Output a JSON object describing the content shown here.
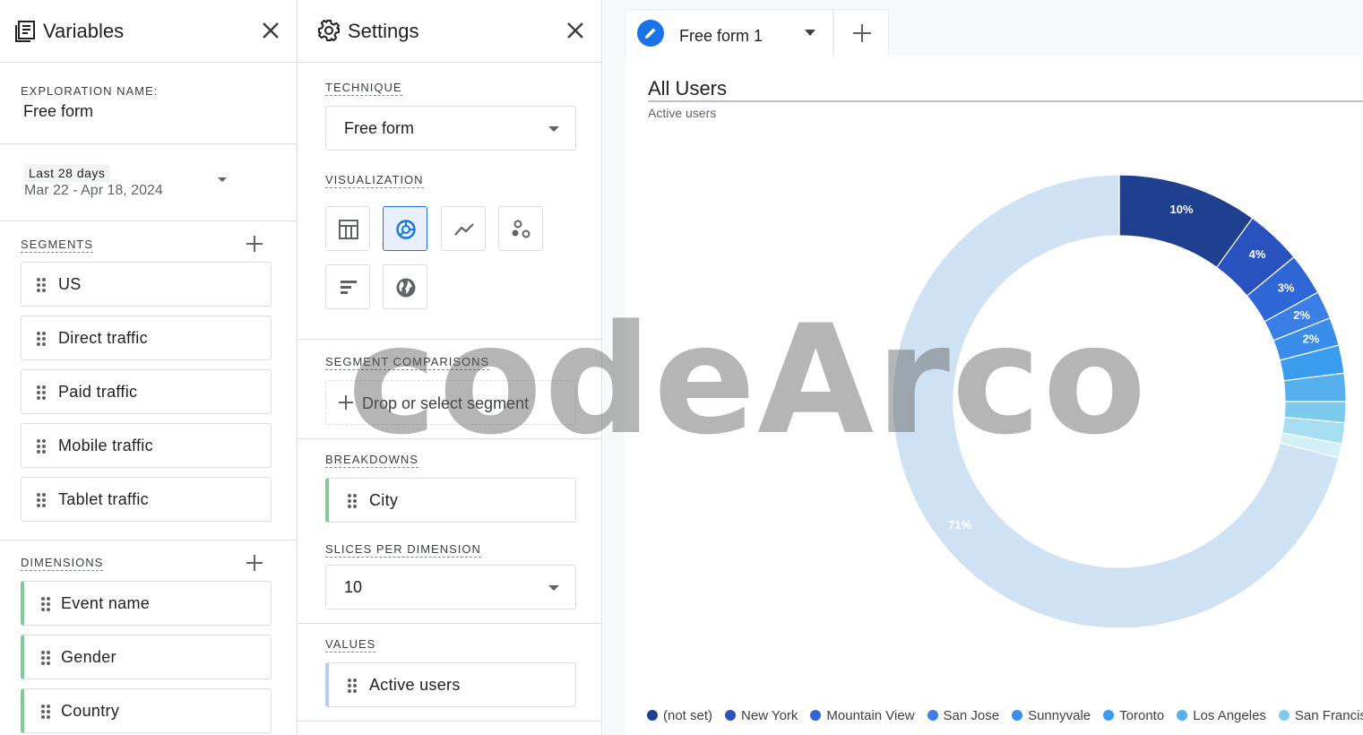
{
  "variables": {
    "title": "Variables",
    "exploration_label": "EXPLORATION NAME:",
    "exploration_name": "Free form",
    "date_range_label": "Last 28 days",
    "date_range": "Mar 22 - Apr 18, 2024",
    "segments_label": "SEGMENTS",
    "segments": [
      "US",
      "Direct traffic",
      "Paid traffic",
      "Mobile traffic",
      "Tablet traffic"
    ],
    "dimensions_label": "DIMENSIONS",
    "dimensions": [
      "Event name",
      "Gender",
      "Country"
    ]
  },
  "settings": {
    "title": "Settings",
    "technique_label": "TECHNIQUE",
    "technique": "Free form",
    "visualization_label": "VISUALIZATION",
    "visualization_options": [
      "table-icon",
      "donut-chart-icon",
      "line-chart-icon",
      "scatter-plot-icon",
      "bar-chart-icon",
      "geo-map-icon"
    ],
    "selected_visualization": "donut-chart-icon",
    "segment_comparisons_label": "SEGMENT COMPARISONS",
    "segment_drop_text": "Drop or select segment",
    "breakdowns_label": "BREAKDOWNS",
    "breakdown": "City",
    "slices_label": "SLICES PER DIMENSION",
    "slices": "10",
    "values_label": "VALUES",
    "value": "Active users"
  },
  "canvas": {
    "tab_name": "Free form 1",
    "chart_title": "All Users",
    "chart_subtitle": "Active users"
  },
  "watermark": "codeArco",
  "chart_data": {
    "type": "pie",
    "donut": true,
    "slices": [
      {
        "label": "(not set)",
        "value": 10,
        "color": "#1f3f8f",
        "shown": "10%"
      },
      {
        "label": "New York",
        "value": 4,
        "color": "#2a52be",
        "shown": "4%"
      },
      {
        "label": "Mountain View",
        "value": 3,
        "color": "#2f66d6",
        "shown": "3%"
      },
      {
        "label": "San Jose",
        "value": 2,
        "color": "#3b7ee6",
        "shown": "2%"
      },
      {
        "label": "Sunnyvale",
        "value": 2,
        "color": "#3a8dea",
        "shown": "2%"
      },
      {
        "label": "Toronto",
        "value": 2,
        "color": "#3a9cec",
        "shown": ""
      },
      {
        "label": "Los Angeles",
        "value": 2,
        "color": "#56b0ee",
        "shown": ""
      },
      {
        "label": "San Francisco",
        "value": 1.5,
        "color": "#7ccbef",
        "shown": ""
      },
      {
        "label": "",
        "value": 1.5,
        "color": "#a7ddf1",
        "shown": ""
      },
      {
        "label": "",
        "value": 1,
        "color": "#d3f0f8",
        "shown": ""
      },
      {
        "label": "",
        "value": 71,
        "color": "#cfe2f3",
        "shown": "71%"
      }
    ],
    "legend": [
      {
        "label": "(not set)",
        "color": "#1f3f8f"
      },
      {
        "label": "New York",
        "color": "#2a52be"
      },
      {
        "label": "Mountain View",
        "color": "#2f66d6"
      },
      {
        "label": "San Jose",
        "color": "#3b7ee6"
      },
      {
        "label": "Sunnyvale",
        "color": "#3a8dea"
      },
      {
        "label": "Toronto",
        "color": "#3a9cec"
      },
      {
        "label": "Los Angeles",
        "color": "#56b0ee"
      },
      {
        "label": "San Francisco",
        "color": "#7ccbef"
      }
    ]
  }
}
